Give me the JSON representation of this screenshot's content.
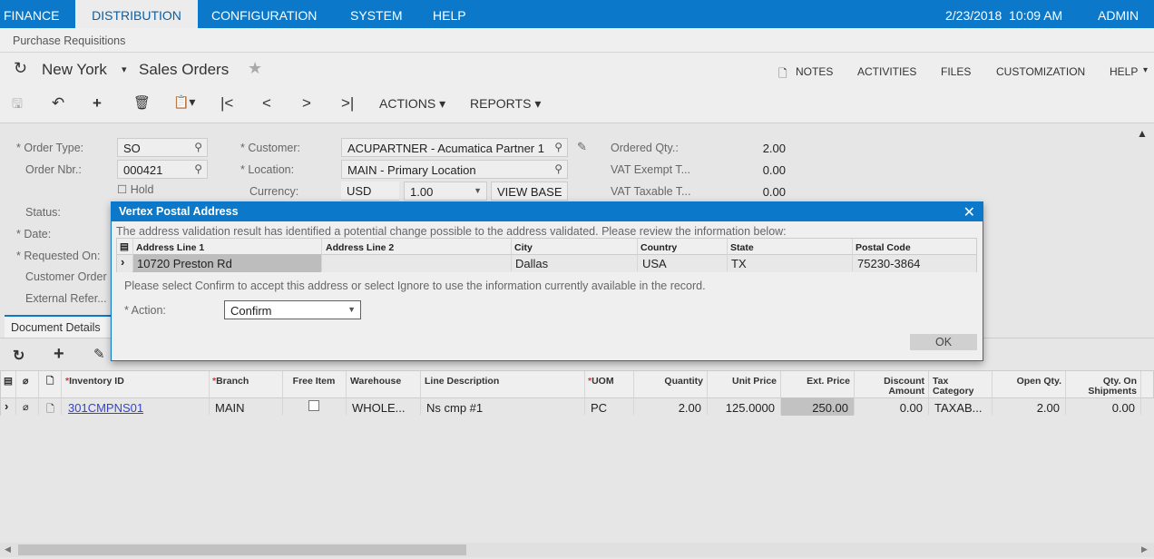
{
  "topnav": {
    "tabs": [
      "FINANCE",
      "DISTRIBUTION",
      "CONFIGURATION",
      "SYSTEM",
      "HELP"
    ],
    "active": "DISTRIBUTION",
    "datetime": "2/23/2018  10:09 AM",
    "user": "ADMIN"
  },
  "breadcrumb": "Purchase Requisitions",
  "title": {
    "branch": "New York",
    "screen": "Sales Orders"
  },
  "title_links": {
    "notes": "NOTES",
    "activities": "ACTIVITIES",
    "files": "FILES",
    "customization": "CUSTOMIZATION",
    "help": "HELP"
  },
  "toolbar": {
    "actions": "ACTIONS",
    "reports": "REPORTS"
  },
  "form": {
    "order_type_label": "Order Type:",
    "order_type": "SO",
    "order_nbr_label": "Order Nbr.:",
    "order_nbr": "000421",
    "hold_label": "Hold",
    "status_label": "Status:",
    "date_label": "Date:",
    "requested_on_label": "Requested On:",
    "customer_order_label": "Customer Order",
    "external_ref_label": "External Refer...",
    "customer_label": "Customer:",
    "customer": "ACUPARTNER - Acumatica Partner 1",
    "location_label": "Location:",
    "location": "MAIN - Primary Location",
    "currency_label": "Currency:",
    "currency": "USD",
    "rate": "1.00",
    "view_base": "VIEW BASE",
    "ordered_qty_label": "Ordered Qty.:",
    "ordered_qty": "2.00",
    "vat_exempt_label": "VAT Exempt T...",
    "vat_exempt": "0.00",
    "vat_taxable_label": "VAT Taxable T...",
    "vat_taxable": "0.00"
  },
  "tabs": {
    "document_details": "Document Details"
  },
  "dialog": {
    "title": "Vertex Postal Address",
    "message": "The address validation result has identified a potential change possible to the address validated. Please review the information below:",
    "columns": [
      "Address Line 1",
      "Address Line 2",
      "City",
      "Country",
      "State",
      "Postal Code"
    ],
    "row": [
      "10720 Preston Rd",
      "",
      "Dallas",
      "USA",
      "TX",
      "75230-3864"
    ],
    "instruction": "Please select Confirm to accept this address or select Ignore to use the information currently available in the record.",
    "action_label": "Action:",
    "action_value": "Confirm",
    "ok": "OK"
  },
  "grid": {
    "columns": [
      "Inventory ID",
      "Branch",
      "Free Item",
      "Warehouse",
      "Line Description",
      "UOM",
      "Quantity",
      "Unit Price",
      "Ext. Price",
      "Discount Amount",
      "Tax Category",
      "Open Qty.",
      "Qty. On Shipments"
    ],
    "row": {
      "inventory_id": "301CMPNS01",
      "branch": "MAIN",
      "free_item": false,
      "warehouse": "WHOLE...",
      "description": "Ns cmp #1",
      "uom": "PC",
      "quantity": "2.00",
      "unit_price": "125.0000",
      "ext_price": "250.00",
      "discount": "0.00",
      "tax_category": "TAXAB...",
      "open_qty": "2.00",
      "qty_on_shipments": "0.00"
    }
  },
  "colors": {
    "brand": "#0b78c9",
    "background": "#e6e6e6"
  }
}
